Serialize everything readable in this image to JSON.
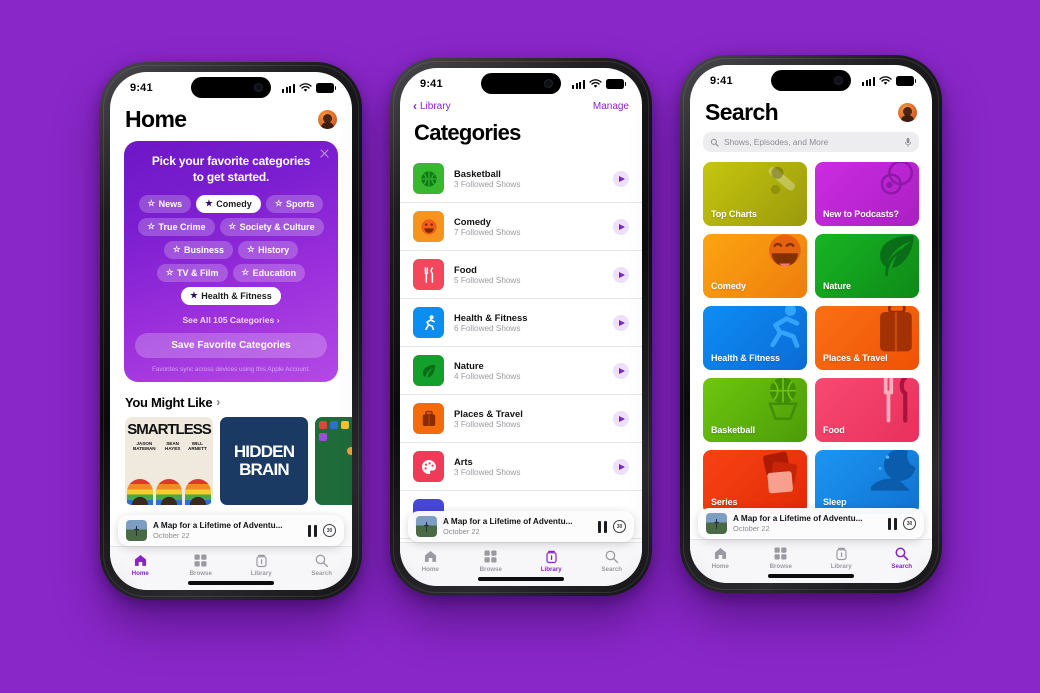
{
  "background_color": "#8a27c9",
  "accent_color": "#8a22c9",
  "status_bar": {
    "time": "9:41"
  },
  "phone1": {
    "screen_name": "Home",
    "title": "Home",
    "avatar_name": "user-avatar",
    "promo": {
      "title": "Pick your favorite categories to get started.",
      "chips": [
        {
          "label": "News",
          "selected": false
        },
        {
          "label": "Comedy",
          "selected": true
        },
        {
          "label": "Sports",
          "selected": false
        },
        {
          "label": "True Crime",
          "selected": false
        },
        {
          "label": "Society & Culture",
          "selected": false
        },
        {
          "label": "Business",
          "selected": false
        },
        {
          "label": "History",
          "selected": false
        },
        {
          "label": "TV & Film",
          "selected": false
        },
        {
          "label": "Education",
          "selected": false
        },
        {
          "label": "Health & Fitness",
          "selected": true
        }
      ],
      "see_all": "See All 105 Categories ›",
      "save_button": "Save Favorite Categories",
      "footnote": "Favorites sync across devices using this Apple Account.",
      "close_icon": "close-icon"
    },
    "section": {
      "title": "You Might Like",
      "chevron": "›"
    },
    "carousel": [
      {
        "title": "SMARTLESS",
        "hosts": [
          "JASON BATEMAN",
          "SEAN HAYES",
          "WILL ARNETT"
        ]
      },
      {
        "title": "HIDDEN BRAIN"
      },
      {
        "title": ""
      }
    ]
  },
  "phone2": {
    "screen_name": "Categories",
    "back_label": "Library",
    "manage_label": "Manage",
    "title": "Categories",
    "rows": [
      {
        "name": "Basketball",
        "sub": "3 Followed Shows",
        "color": "#37b82e",
        "icon": "basketball-icon"
      },
      {
        "name": "Comedy",
        "sub": "7 Followed Shows",
        "color": "#f7941d",
        "icon": "smiley-icon"
      },
      {
        "name": "Food",
        "sub": "5 Followed Shows",
        "color": "#f2475c",
        "icon": "cutlery-icon"
      },
      {
        "name": "Health & Fitness",
        "sub": "6 Followed Shows",
        "color": "#0b8ef0",
        "icon": "runner-icon"
      },
      {
        "name": "Nature",
        "sub": "4 Followed Shows",
        "color": "#13a02a",
        "icon": "leaf-icon"
      },
      {
        "name": "Places & Travel",
        "sub": "3 Followed Shows",
        "color": "#f46b0c",
        "icon": "suitcase-icon"
      },
      {
        "name": "Arts",
        "sub": "3 Followed Shows",
        "color": "#ef3b57",
        "icon": "palette-icon"
      }
    ]
  },
  "phone3": {
    "screen_name": "Search",
    "title": "Search",
    "search_placeholder": "Shows, Episodes, and More",
    "search_value": "",
    "search_icon": "search-icon",
    "mic_icon": "microphone-icon",
    "tiles": [
      {
        "label": "Top Charts",
        "color": "#b5b510",
        "icon": "charts-icon"
      },
      {
        "label": "New to Podcasts?",
        "color": "#c42ad8",
        "icon": "rings-icon"
      },
      {
        "label": "Comedy",
        "color": "#f79a12",
        "icon": "smiley-icon"
      },
      {
        "label": "Nature",
        "color": "#15a51f",
        "icon": "leaf-icon"
      },
      {
        "label": "Health & Fitness",
        "color": "#0b7ff0",
        "icon": "runner-icon"
      },
      {
        "label": "Places & Travel",
        "color": "#f4600c",
        "icon": "suitcase-icon"
      },
      {
        "label": "Basketball",
        "color": "#5fb80c",
        "icon": "basketball-icon"
      },
      {
        "label": "Food",
        "color": "#f2416b",
        "icon": "cutlery-icon"
      },
      {
        "label": "Series",
        "color": "#ef3410",
        "icon": "stack-icon"
      },
      {
        "label": "Sleep",
        "color": "#1388e8",
        "icon": "moon-icon"
      }
    ]
  },
  "mini_player": {
    "title": "A Map for a Lifetime of Adventu...",
    "subtitle": "October 22",
    "pause_icon": "pause-icon",
    "skip_label": "30",
    "skip_icon": "skip-forward-30-icon"
  },
  "tabs": [
    {
      "label": "Home",
      "icon": "home-icon"
    },
    {
      "label": "Browse",
      "icon": "grid-icon"
    },
    {
      "label": "Library",
      "icon": "library-icon"
    },
    {
      "label": "Search",
      "icon": "search-icon"
    }
  ],
  "active_tab": {
    "phone1": 0,
    "phone2": 2,
    "phone3": 3
  }
}
